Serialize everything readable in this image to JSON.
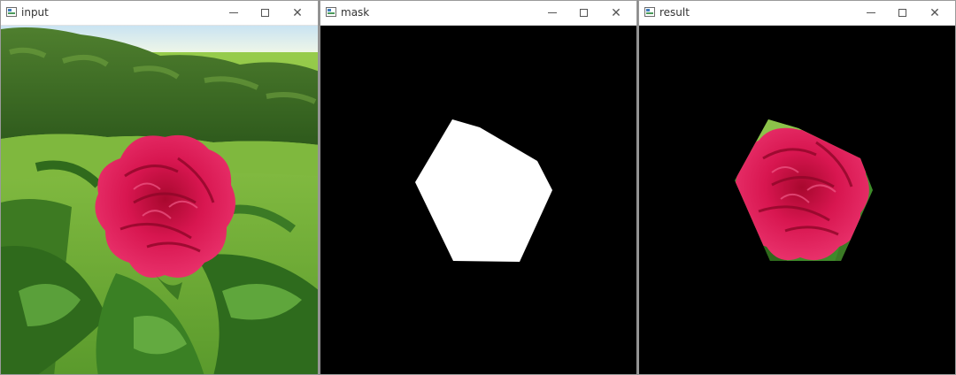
{
  "windows": [
    {
      "id": "input",
      "title": "input",
      "image": "photo of a red peony flower with green leaves and hedges"
    },
    {
      "id": "mask",
      "title": "mask",
      "image": "white pentagon shape on black background"
    },
    {
      "id": "result",
      "title": "result",
      "image": "peony flower cut out by the pentagon mask on black background"
    }
  ],
  "icons": {
    "app": "app-icon",
    "minimize": "minimize-icon",
    "maximize": "maximize-icon",
    "close": "close-icon"
  },
  "colors": {
    "titlebar": "#ffffff",
    "image_background": "#000000",
    "flower": "#d0104a",
    "foliage": "#3f8a2a"
  }
}
